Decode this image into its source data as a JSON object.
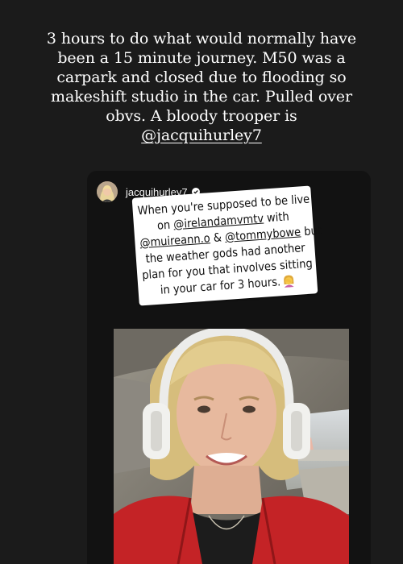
{
  "story": {
    "caption_lines": [
      "3 hours to do what would normally have",
      "been a  15 minute journey. M50 was a",
      "carpark and closed due to flooding so",
      "makeshift studio in the car. Pulled over",
      "obvs. A bloody trooper is"
    ],
    "caption_mention": "@jacquihurley7",
    "background_color": "#1b1b1b"
  },
  "shared_post": {
    "username": "jacquihurley7",
    "verified": true,
    "avatar_icon": "profile-avatar-icon",
    "sticker": {
      "line_1": "When you're supposed to be live",
      "line_2_prefix": "on ",
      "line_2_tag": "@irelandamvmtv",
      "line_2_suffix": " with",
      "line_3_tag_1": "@muireann.o",
      "line_3_mid": " & ",
      "line_3_tag_2": "@tommybowe",
      "line_3_suffix": " but",
      "line_4": "the weather gods had another",
      "line_5": "plan for you that involves sitting",
      "line_6": "in your car for 3 hours.",
      "emoji_icon": "woman-facepalming-emoji"
    },
    "media": {
      "type": "video-frame",
      "icon": "person-with-headphones-in-car"
    }
  }
}
